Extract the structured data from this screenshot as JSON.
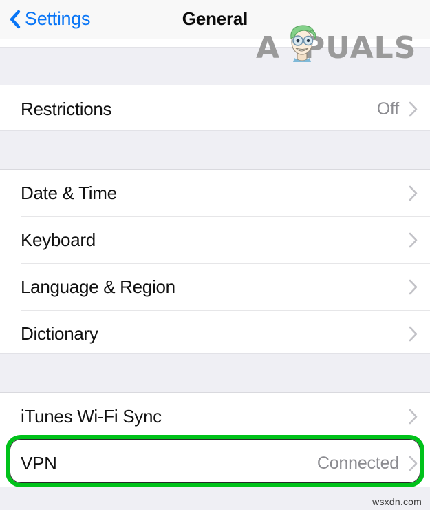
{
  "navbar": {
    "back_label": "Settings",
    "back_icon": "chevron-left-icon",
    "title": "General"
  },
  "sections": [
    {
      "id": "restrictions-group",
      "rows": [
        {
          "label": "Restrictions",
          "value": "Off",
          "accessory": "chevron-right-icon"
        }
      ]
    },
    {
      "id": "system-group",
      "rows": [
        {
          "label": "Date & Time",
          "value": "",
          "accessory": "chevron-right-icon"
        },
        {
          "label": "Keyboard",
          "value": "",
          "accessory": "chevron-right-icon"
        },
        {
          "label": "Language & Region",
          "value": "",
          "accessory": "chevron-right-icon"
        },
        {
          "label": "Dictionary",
          "value": "",
          "accessory": "chevron-right-icon"
        }
      ]
    },
    {
      "id": "sync-group",
      "rows": [
        {
          "label": "iTunes Wi-Fi Sync",
          "value": "",
          "accessory": "chevron-right-icon"
        },
        {
          "label": "VPN",
          "value": "Connected",
          "accessory": "chevron-right-icon"
        }
      ]
    }
  ],
  "annotation": {
    "target_row": "VPN",
    "shape": "rounded-rectangle",
    "color": "#00c21a"
  },
  "watermarks": {
    "brand": "PUALS",
    "brand_initial": "A",
    "brand_mascot": "cartoon-face-icon",
    "footer": "wsxdn.com"
  },
  "colors": {
    "accent_blue": "#007aff",
    "value_gray": "#8c8c91",
    "chevron_gray": "#c7c7cc",
    "group_background": "#efeff4",
    "row_background": "#ffffff",
    "highlight_green": "#00c21a"
  }
}
